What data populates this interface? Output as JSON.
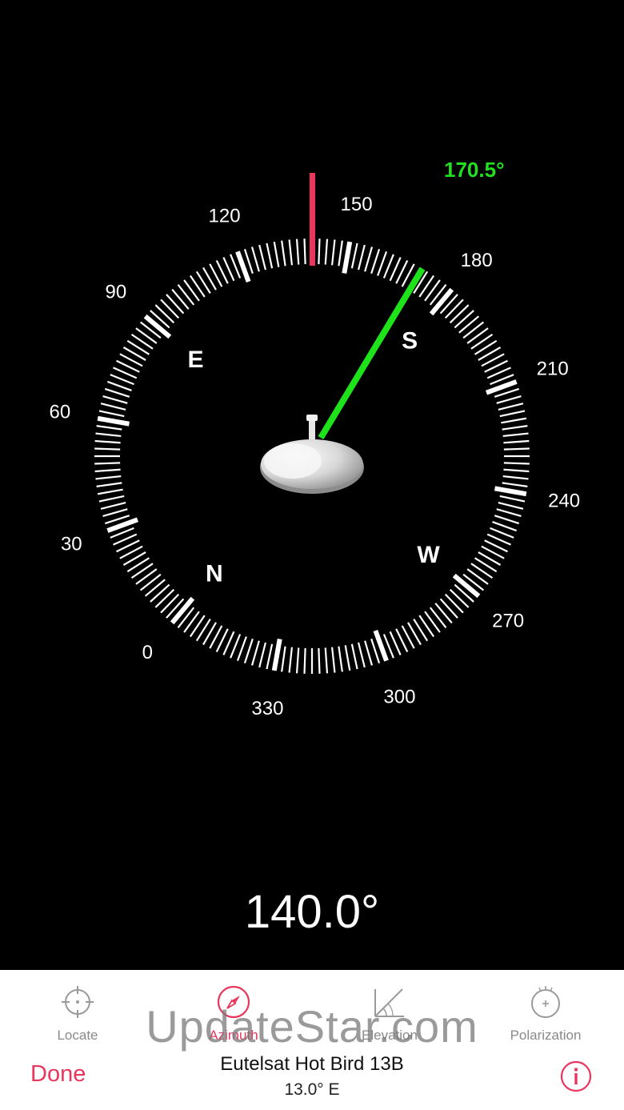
{
  "compass": {
    "dial_labels": [
      "0",
      "30",
      "60",
      "90",
      "120",
      "150",
      "180",
      "210",
      "240",
      "270",
      "300",
      "330"
    ],
    "cardinals": [
      "N",
      "E",
      "S",
      "W"
    ],
    "target_azimuth_text": "170.5°",
    "target_azimuth": 170.5,
    "device_heading": 140.0,
    "colors": {
      "target_needle": "#1ee31b",
      "heading_marker": "#e8365d",
      "ticks": "#ffffff"
    }
  },
  "heading_readout": "140.0°",
  "toolbar": {
    "tabs": [
      {
        "label": "Locate",
        "icon": "crosshair-icon"
      },
      {
        "label": "Azimuth",
        "icon": "compass-icon",
        "active": true
      },
      {
        "label": "Elevation",
        "icon": "elevation-angle-icon"
      },
      {
        "label": "Polarization",
        "icon": "polarization-dial-icon"
      }
    ],
    "done_label": "Done",
    "satellite_name": "Eutelsat Hot Bird 13B",
    "satellite_position": "13.0° E",
    "info_icon": "info-icon",
    "accent_color": "#e8365d"
  },
  "watermark": "UpdateStar.com"
}
